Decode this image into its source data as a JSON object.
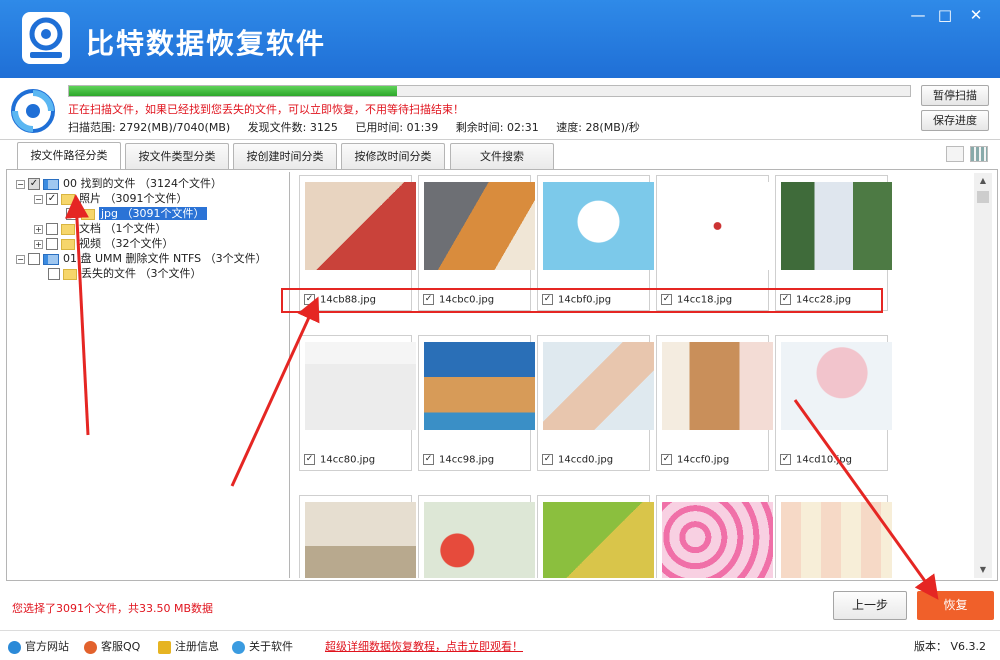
{
  "app": {
    "title": "比特数据恢复软件",
    "window_buttons": [
      "minimize-icon",
      "maximize-icon",
      "close-icon"
    ]
  },
  "scan": {
    "progress": 0.39,
    "message": "正在扫描文件，如果已经找到您丢失的文件，可以立即恢复，不用等待扫描结束！",
    "range_label": "扫描范围:",
    "range_value": "2792(MB)/7040(MB)",
    "found_label": "发现文件数:",
    "found_value": "3125",
    "elapsed_label": "已用时间:",
    "elapsed_value": "01:39",
    "remaining_label": "剩余时间:",
    "remaining_value": "02:31",
    "speed_label": "速度:",
    "speed_value": "28(MB)/秒",
    "pause_button": "暂停扫描",
    "save_button": "保存进度"
  },
  "tabs": [
    {
      "label": "按文件路径分类",
      "active": true
    },
    {
      "label": "按文件类型分类",
      "active": false
    },
    {
      "label": "按创建时间分类",
      "active": false
    },
    {
      "label": "按修改时间分类",
      "active": false
    },
    {
      "label": "文件搜索",
      "active": false
    }
  ],
  "tree": {
    "root1": "00 找到的文件 （3124个文件）",
    "photos": "照片 （3091个文件）",
    "jpg": "jpg （3091个文件）",
    "docs": "文档 （1个文件）",
    "video": "视频 （32个文件）",
    "root2": "01 盘 UMM 删除文件 NTFS （3个文件）",
    "lost": "丢失的文件 （3个文件）"
  },
  "files": [
    {
      "name": "14cb88.jpg",
      "checked": true
    },
    {
      "name": "14cbc0.jpg",
      "checked": true
    },
    {
      "name": "14cbf0.jpg",
      "checked": true
    },
    {
      "name": "14cc18.jpg",
      "checked": true
    },
    {
      "name": "14cc28.jpg",
      "checked": true
    },
    {
      "name": "14cc80.jpg",
      "checked": true
    },
    {
      "name": "14cc98.jpg",
      "checked": true
    },
    {
      "name": "14ccd0.jpg",
      "checked": true
    },
    {
      "name": "14ccf0.jpg",
      "checked": true
    },
    {
      "name": "14cd10.jpg",
      "checked": true
    }
  ],
  "status": {
    "selection_info": "您选择了3091个文件，共33.50 MB数据",
    "prev_button": "上一步",
    "recover_button": "恢复"
  },
  "footer": {
    "website": "官方网站",
    "qq": "客服QQ",
    "register": "注册信息",
    "about": "关于软件",
    "promo": "超级详细数据恢复教程，点击立即观看！",
    "version": "版本：  V6.3.2"
  },
  "colors": {
    "title_bar": "#1f6fd6",
    "progress_fill": "#2ea72b",
    "alert_text": "#e0141e",
    "recover_button": "#f0602a",
    "annotation": "#e52623"
  }
}
